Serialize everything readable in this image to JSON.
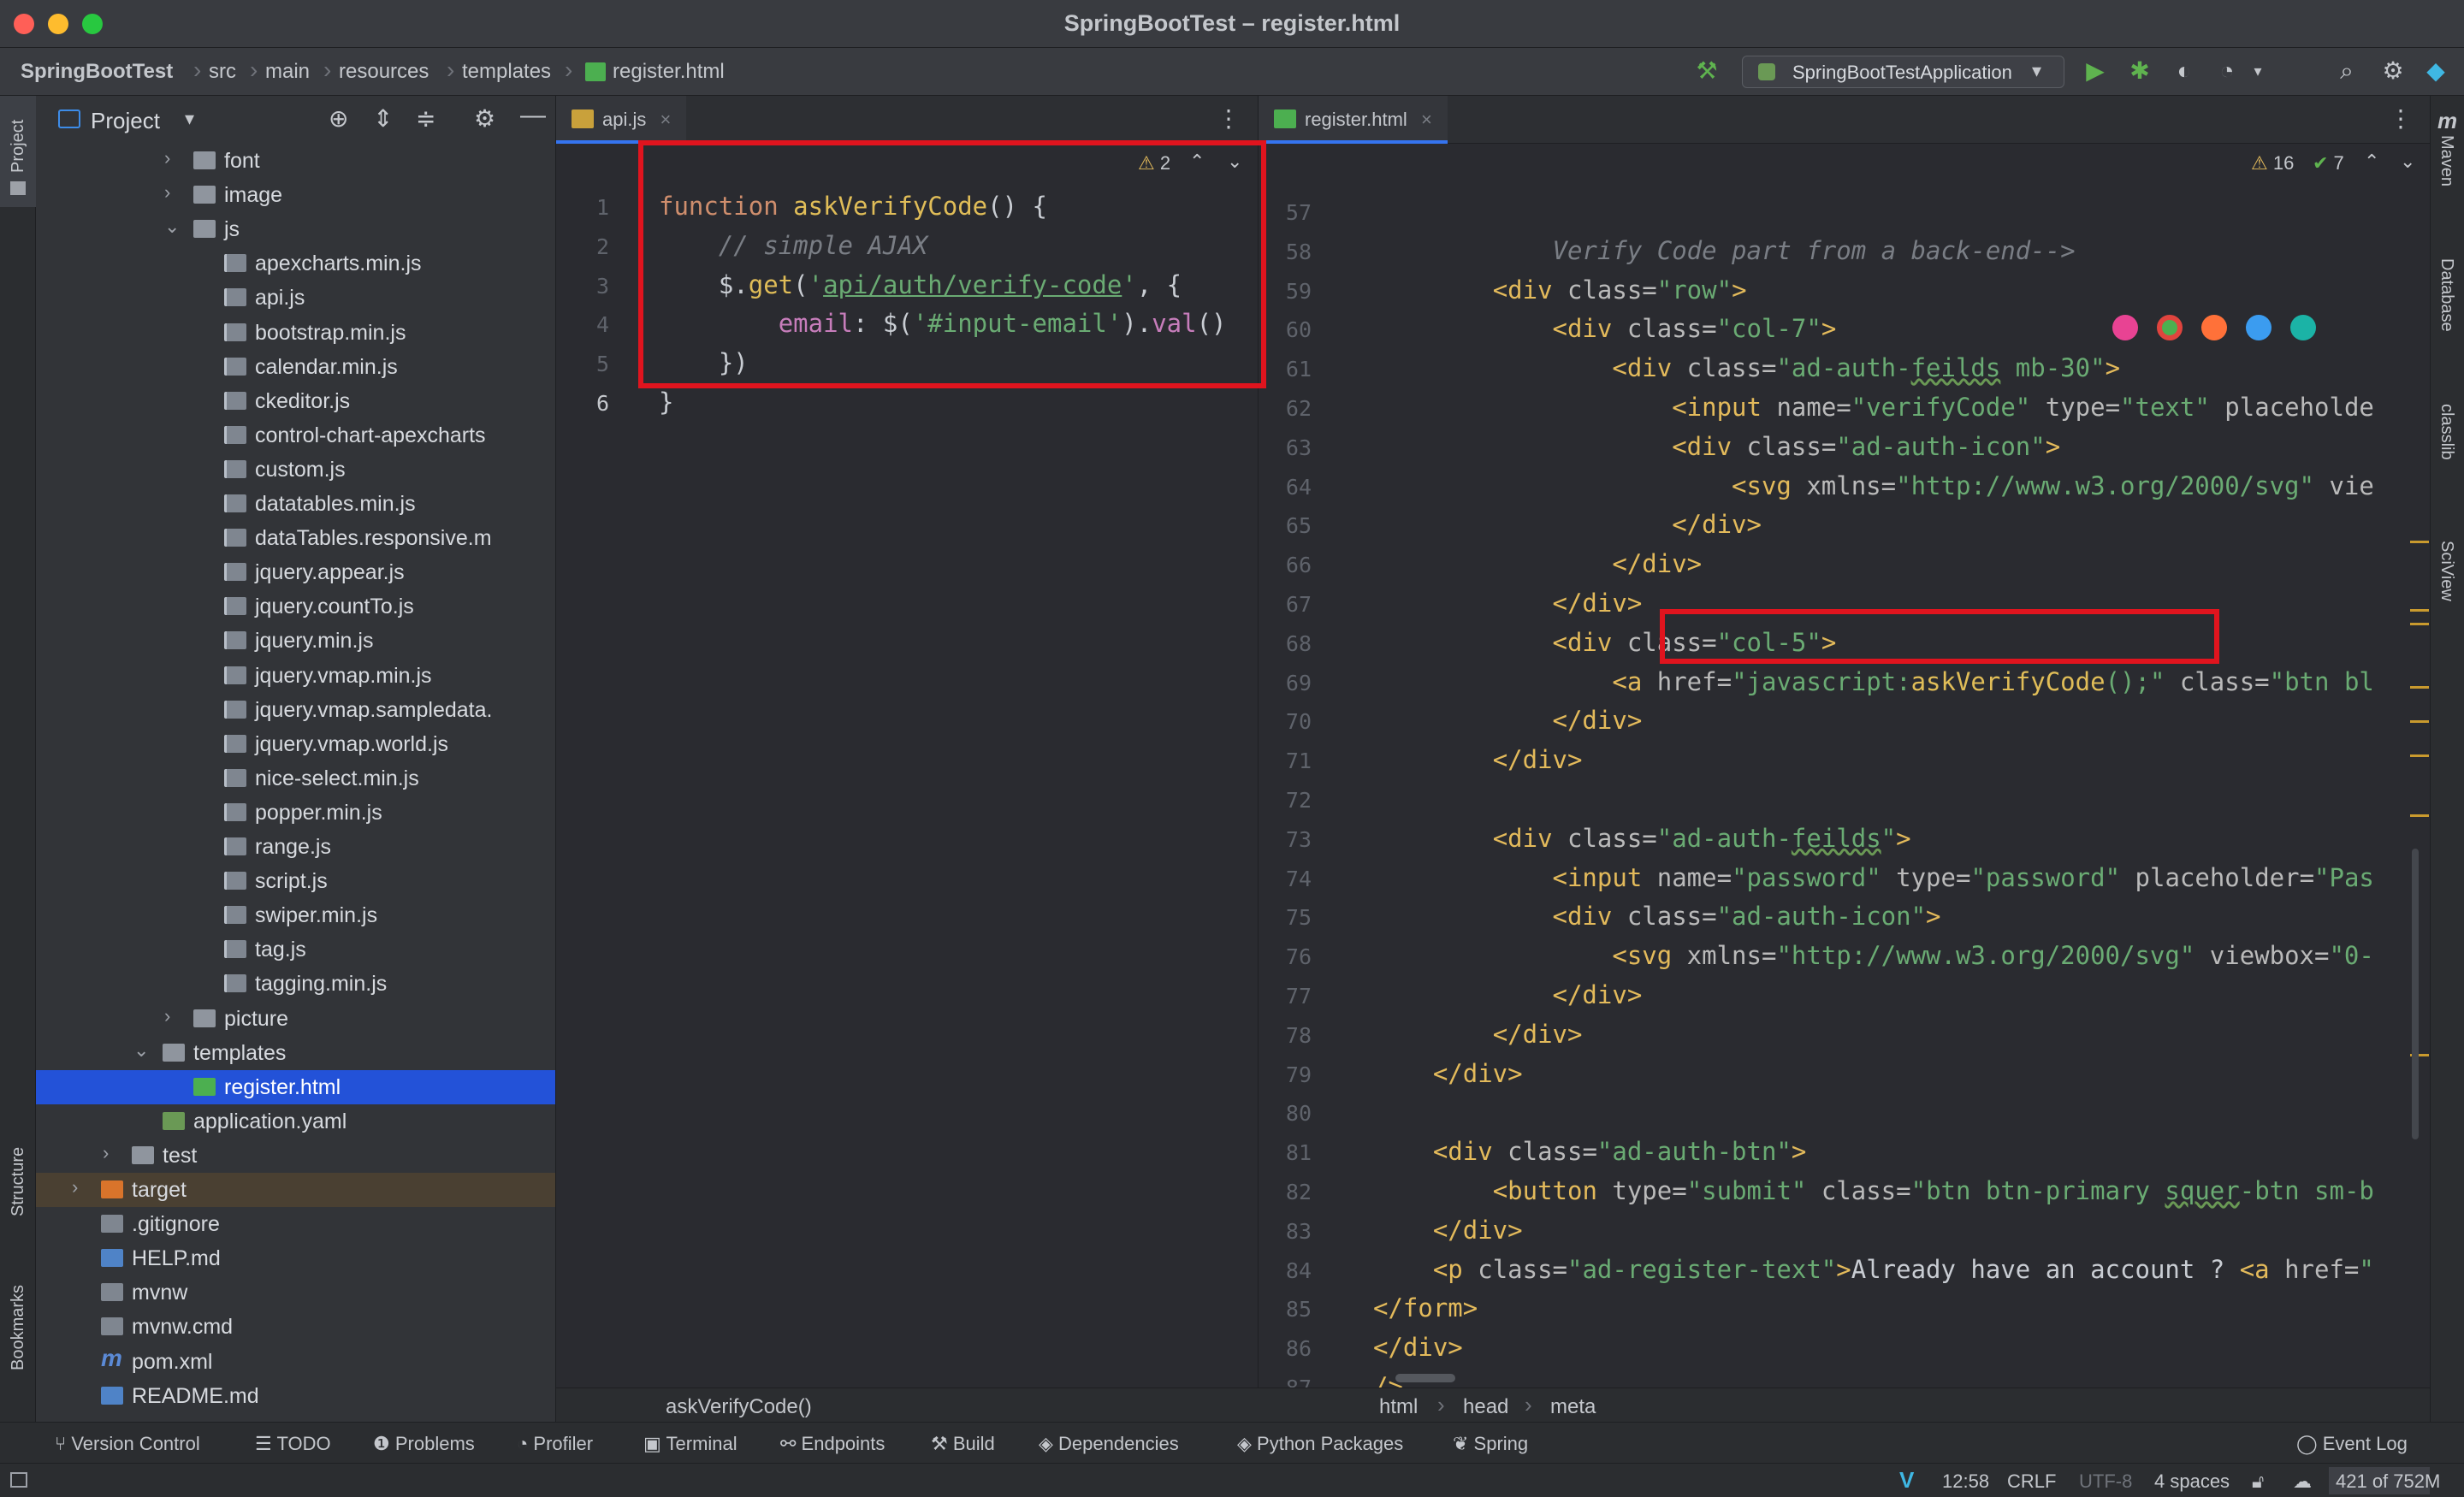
{
  "window": {
    "title": "SpringBootTest – register.html"
  },
  "breadcrumbs": [
    "SpringBootTest",
    "src",
    "main",
    "resources",
    "templates",
    "register.html"
  ],
  "run_config": "SpringBootTestApplication",
  "project_panel": {
    "title": "Project",
    "rows": [
      {
        "label": "font",
        "type": "folder",
        "depth": 2,
        "arrow": "›"
      },
      {
        "label": "image",
        "type": "folder",
        "depth": 2,
        "arrow": "›"
      },
      {
        "label": "js",
        "type": "folder",
        "depth": 2,
        "arrow": "⌄"
      },
      {
        "label": "apexcharts.min.js",
        "type": "js",
        "depth": 3
      },
      {
        "label": "api.js",
        "type": "js",
        "depth": 3
      },
      {
        "label": "bootstrap.min.js",
        "type": "js",
        "depth": 3
      },
      {
        "label": "calendar.min.js",
        "type": "js",
        "depth": 3
      },
      {
        "label": "ckeditor.js",
        "type": "js",
        "depth": 3
      },
      {
        "label": "control-chart-apexcharts",
        "type": "js",
        "depth": 3
      },
      {
        "label": "custom.js",
        "type": "js",
        "depth": 3
      },
      {
        "label": "datatables.min.js",
        "type": "js",
        "depth": 3
      },
      {
        "label": "dataTables.responsive.m",
        "type": "js",
        "depth": 3
      },
      {
        "label": "jquery.appear.js",
        "type": "js",
        "depth": 3
      },
      {
        "label": "jquery.countTo.js",
        "type": "js",
        "depth": 3
      },
      {
        "label": "jquery.min.js",
        "type": "js",
        "depth": 3
      },
      {
        "label": "jquery.vmap.min.js",
        "type": "js",
        "depth": 3
      },
      {
        "label": "jquery.vmap.sampledata.",
        "type": "js",
        "depth": 3
      },
      {
        "label": "jquery.vmap.world.js",
        "type": "js",
        "depth": 3
      },
      {
        "label": "nice-select.min.js",
        "type": "js",
        "depth": 3
      },
      {
        "label": "popper.min.js",
        "type": "js",
        "depth": 3
      },
      {
        "label": "range.js",
        "type": "js",
        "depth": 3
      },
      {
        "label": "script.js",
        "type": "js",
        "depth": 3
      },
      {
        "label": "swiper.min.js",
        "type": "js",
        "depth": 3
      },
      {
        "label": "tag.js",
        "type": "js",
        "depth": 3
      },
      {
        "label": "tagging.min.js",
        "type": "js",
        "depth": 3
      },
      {
        "label": "picture",
        "type": "folder",
        "depth": 2,
        "arrow": "›"
      },
      {
        "label": "templates",
        "type": "folder",
        "depth": 1,
        "arrow": "⌄"
      },
      {
        "label": "register.html",
        "type": "html",
        "depth": 2,
        "selected": true
      },
      {
        "label": "application.yaml",
        "type": "yaml",
        "depth": 1
      },
      {
        "label": "test",
        "type": "folder",
        "depth": 0,
        "arrow": "›"
      },
      {
        "label": "target",
        "type": "folder-or",
        "depth": -1,
        "arrow": "›",
        "highlight": true
      },
      {
        "label": ".gitignore",
        "type": "file",
        "depth": -1
      },
      {
        "label": "HELP.md",
        "type": "md",
        "depth": -1
      },
      {
        "label": "mvnw",
        "type": "file",
        "depth": -1
      },
      {
        "label": "mvnw.cmd",
        "type": "file",
        "depth": -1
      },
      {
        "label": "pom.xml",
        "type": "mvn",
        "depth": -1
      },
      {
        "label": "README.md",
        "type": "md",
        "depth": -1
      }
    ]
  },
  "editor_left": {
    "tab": "api.js",
    "warning_count": "2",
    "first_line": 1,
    "lines": [
      "<span class=\"kw\">function</span> <span class=\"fn\">askVerifyCode</span>() {",
      "    <span class=\"cm\">// simple AJAX</span>",
      "    $.<span class=\"fn\">get</span>(<span class=\"str\">'<u>api/auth/verify-code</u>'</span>, {",
      "        <span style=\"color:#c77dbb\">email</span>: $(<span class=\"str\">'#input-email'</span>).<span style=\"color:#c77dbb\">val</span>()",
      "    })",
      "}"
    ],
    "footer_context": "askVerifyCode()"
  },
  "editor_right": {
    "tab": "register.html",
    "warnings": "16",
    "checks": "7",
    "first_line": 57,
    "lines": [
      "",
      "            <span class=\"cm\">Verify Code part from a back-end--></span>",
      "        <span class=\"tag\">&lt;div</span> <span class=\"attr\">class=</span><span class=\"val\">\"row\"</span><span class=\"tag\">&gt;</span>",
      "            <span class=\"tag\">&lt;div</span> <span class=\"attr\">class=</span><span class=\"val\">\"col-7\"</span><span class=\"tag\">&gt;</span>",
      "                <span class=\"tag\">&lt;div</span> <span class=\"attr\">class=</span><span class=\"val\">\"ad-auth-<span class=\"wave\">feilds</span> mb-30\"</span><span class=\"tag\">&gt;</span>",
      "                    <span class=\"tag\">&lt;input</span> <span class=\"attr\">name=</span><span class=\"val\">\"verifyCode\"</span> <span class=\"attr\">type=</span><span class=\"val\">\"text\"</span> <span class=\"attr\">placeholde</span>",
      "                    <span class=\"tag\">&lt;div</span> <span class=\"attr\">class=</span><span class=\"val\">\"ad-auth-icon\"</span><span class=\"tag\">&gt;</span>",
      "                        <span class=\"tag\">&lt;svg</span> <span class=\"attr\">xmlns=</span><span class=\"val\">\"http://www.w3.org/2000/svg\"</span> <span class=\"attr\">vie</span>",
      "                    <span class=\"tag\">&lt;/div&gt;</span>",
      "                <span class=\"tag\">&lt;/div&gt;</span>",
      "            <span class=\"tag\">&lt;/div&gt;</span>",
      "            <span class=\"tag\">&lt;div</span> <span class=\"attr\">class=</span><span class=\"val\">\"col-5\"</span><span class=\"tag\">&gt;</span>",
      "                <span class=\"tag\">&lt;a</span> <span class=\"attr\">href=</span><span class=\"val\">\"javascript:<span class=\"fn\">askVerifyCode</span>();\"</span> <span class=\"attr\">class=</span><span class=\"val\">\"btn bl</span>",
      "            <span class=\"tag\">&lt;/div&gt;</span>",
      "        <span class=\"tag\">&lt;/div&gt;</span>",
      "",
      "        <span class=\"tag\">&lt;div</span> <span class=\"attr\">class=</span><span class=\"val\">\"ad-auth-<span class=\"wave\">feilds</span>\"</span><span class=\"tag\">&gt;</span>",
      "            <span class=\"tag\">&lt;input</span> <span class=\"attr\">name=</span><span class=\"val\">\"password\"</span> <span class=\"attr\">type=</span><span class=\"val\">\"password\"</span> <span class=\"attr\">placeholder=</span><span class=\"val\">\"Pas</span>",
      "            <span class=\"tag\">&lt;div</span> <span class=\"attr\">class=</span><span class=\"val\">\"ad-auth-icon\"</span><span class=\"tag\">&gt;</span>",
      "                <span class=\"tag\">&lt;svg</span> <span class=\"attr\">xmlns=</span><span class=\"val\">\"http://www.w3.org/2000/svg\"</span> <span class=\"attr\">viewbox=</span><span class=\"val\">\"0-</span>",
      "            <span class=\"tag\">&lt;/div&gt;</span>",
      "        <span class=\"tag\">&lt;/div&gt;</span>",
      "    <span class=\"tag\">&lt;/div&gt;</span>",
      "",
      "    <span class=\"tag\">&lt;div</span> <span class=\"attr\">class=</span><span class=\"val\">\"ad-auth-btn\"</span><span class=\"tag\">&gt;</span>",
      "        <span class=\"tag\">&lt;button</span> <span class=\"attr\">type=</span><span class=\"val\">\"submit\"</span> <span class=\"attr\">class=</span><span class=\"val\">\"btn btn-primary <span class=\"wave\">squer</span>-btn sm-b</span>",
      "    <span class=\"tag\">&lt;/div&gt;</span>",
      "    <span class=\"tag\">&lt;p</span> <span class=\"attr\">class=</span><span class=\"val\">\"ad-register-text\"</span><span class=\"tag\">&gt;</span>Already have an account ? <span class=\"tag\">&lt;a</span> <span class=\"attr\">href=</span><span class=\"val\">\"</span>",
      "<span class=\"tag\">&lt;/form&gt;</span>",
      "<span class=\"tag\">&lt;/div&gt;</span>",
      "<span class=\"tag\">/&gt;</span>",
      ""
    ],
    "footer_crumbs": [
      "html",
      "head",
      "meta"
    ]
  },
  "tool_windows": [
    "Version Control",
    "TODO",
    "Problems",
    "Profiler",
    "Terminal",
    "Endpoints",
    "Build",
    "Dependencies",
    "Python Packages",
    "Spring"
  ],
  "event_log": "Event Log",
  "status": {
    "position": "12:58",
    "line_sep": "CRLF",
    "encoding": "UTF-8",
    "indent": "4 spaces",
    "memory": "421 of 752M"
  },
  "left_strip": [
    "Project",
    "Structure",
    "Bookmarks"
  ],
  "right_strip": [
    "Maven",
    "Database",
    "classlib",
    "SciView"
  ]
}
